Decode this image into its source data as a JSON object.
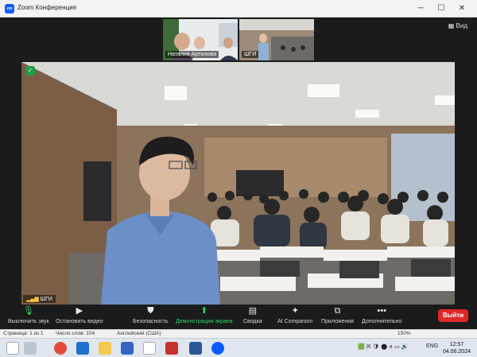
{
  "window": {
    "title": "Zoom Конференция",
    "minimize": "─",
    "maximize": "☐",
    "close": "✕"
  },
  "thumbnails": [
    {
      "name": "Наталия Артюхова"
    },
    {
      "name": "ШГИ"
    }
  ],
  "view_button": "Вид",
  "main_video": {
    "label": "ШГИ",
    "security_icon": "shield-check-icon"
  },
  "toolbar": {
    "mute": "Выключить звук",
    "video": "Остановить видео",
    "security": "Безопасность",
    "share": "Демонстрация экрана",
    "summary": "Сводка",
    "companion": "AI Companion",
    "apps": "Приложения",
    "more": "Дополнительно",
    "leave": "Выйти",
    "share_color": "#2fd36e",
    "leave_color": "#e02828"
  },
  "statusbar": {
    "page": "Страница: 1 из 1",
    "words": "Число слов: 104",
    "language": "Английский (США)",
    "zoom": "150%"
  },
  "taskbar": {
    "language": "ENG",
    "time": "12:57",
    "date": "04.06.2024"
  }
}
